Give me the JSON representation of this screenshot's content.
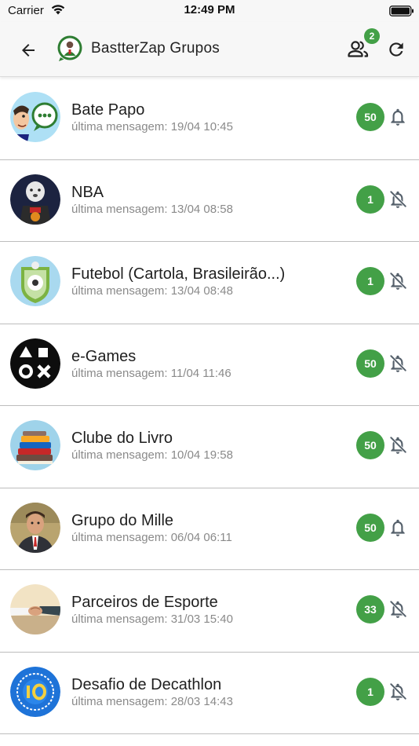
{
  "status_bar": {
    "carrier": "Carrier",
    "time": "12:49 PM"
  },
  "app_bar": {
    "title": "BastterZap Grupos",
    "members_badge": "2"
  },
  "colors": {
    "accent": "#43a047",
    "appbar": "#f7f7f7"
  },
  "groups": [
    {
      "name": "Bate Papo",
      "last": "última mensagem: 19/04 10:45",
      "count": "50",
      "notifications": "on"
    },
    {
      "name": "NBA",
      "last": "última mensagem: 13/04 08:58",
      "count": "1",
      "notifications": "off"
    },
    {
      "name": "Futebol (Cartola, Brasileirão...)",
      "last": "última mensagem: 13/04 08:48",
      "count": "1",
      "notifications": "off"
    },
    {
      "name": "e-Games",
      "last": "última mensagem: 11/04 11:46",
      "count": "50",
      "notifications": "off"
    },
    {
      "name": "Clube do Livro",
      "last": "última mensagem: 10/04 19:58",
      "count": "50",
      "notifications": "off"
    },
    {
      "name": "Grupo do Mille",
      "last": "última mensagem: 06/04 06:11",
      "count": "50",
      "notifications": "on"
    },
    {
      "name": "Parceiros de Esporte",
      "last": "última mensagem: 31/03 15:40",
      "count": "33",
      "notifications": "off"
    },
    {
      "name": "Desafio de Decathlon",
      "last": "última mensagem: 28/03 14:43",
      "count": "1",
      "notifications": "off"
    }
  ]
}
